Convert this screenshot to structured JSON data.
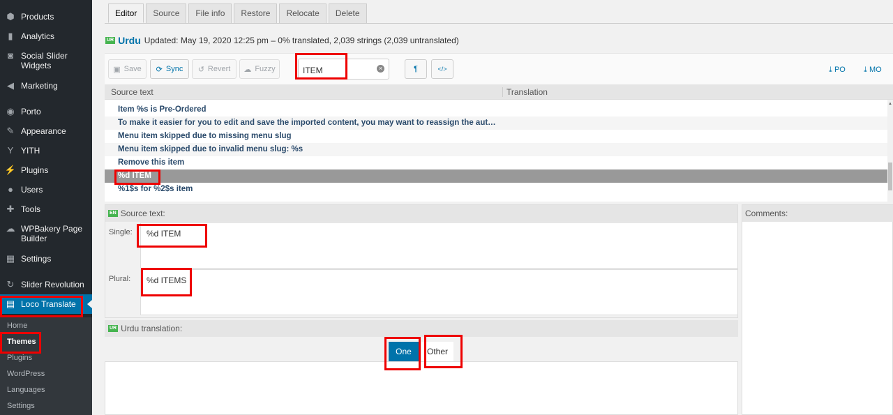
{
  "sidebar": {
    "items": [
      {
        "label": "Products",
        "icon": "box-icon"
      },
      {
        "label": "Analytics",
        "icon": "bar-chart-icon"
      },
      {
        "label": "Social Slider Widgets",
        "icon": "instagram-icon"
      },
      {
        "label": "Marketing",
        "icon": "megaphone-icon"
      },
      {
        "label": "Porto",
        "icon": "circle-icon"
      },
      {
        "label": "Appearance",
        "icon": "paintbrush-icon"
      },
      {
        "label": "YITH",
        "icon": "yith-icon"
      },
      {
        "label": "Plugins",
        "icon": "plug-icon"
      },
      {
        "label": "Users",
        "icon": "user-icon"
      },
      {
        "label": "Tools",
        "icon": "wrench-icon"
      },
      {
        "label": "WPBakery Page Builder",
        "icon": "cloud-icon"
      },
      {
        "label": "Settings",
        "icon": "sliders-icon"
      },
      {
        "label": "Slider Revolution",
        "icon": "refresh-icon"
      },
      {
        "label": "Loco Translate",
        "icon": "translate-icon"
      }
    ],
    "submenu": [
      "Home",
      "Themes",
      "Plugins",
      "WordPress",
      "Languages",
      "Settings"
    ],
    "current_submenu": "Themes"
  },
  "tabs": [
    "Editor",
    "Source",
    "File info",
    "Restore",
    "Relocate",
    "Delete"
  ],
  "active_tab": "Editor",
  "file": {
    "lang_code": "UR",
    "lang_name": "Urdu",
    "status": "Updated: May 19, 2020 12:25 pm – 0% translated, 2,039 strings (2,039 untranslated)"
  },
  "toolbar": {
    "save": "Save",
    "sync": "Sync",
    "revert": "Revert",
    "fuzzy": "Fuzzy",
    "search_value": "ITEM",
    "pilcrow": "¶",
    "code": "</>",
    "po": "PO",
    "mo": "MO"
  },
  "grid": {
    "col_source": "Source text",
    "col_translation": "Translation",
    "rows": [
      "Item %s is Pre-Ordered",
      "To make it easier for you to edit and save the imported content, you may want to reassign the aut…",
      "Menu item skipped due to missing menu slug",
      "Menu item skipped due to invalid menu slug: %s",
      "Remove this item",
      "%d ITEM",
      "%1$s for %2$s item"
    ],
    "selected_index": 5
  },
  "source": {
    "lang_code": "EN",
    "heading": "Source text:",
    "single_label": "Single:",
    "single_value": "%d ITEM",
    "plural_label": "Plural:",
    "plural_value": "%d ITEMS"
  },
  "comments": {
    "heading": "Comments:"
  },
  "translation": {
    "lang_code": "UR",
    "heading": "Urdu translation:",
    "forms": [
      "One",
      "Other"
    ],
    "active_form": "One"
  },
  "colors": {
    "accent": "#0073aa",
    "sidebar": "#23282d",
    "badge": "#46b450",
    "highlight": "#e00000"
  }
}
